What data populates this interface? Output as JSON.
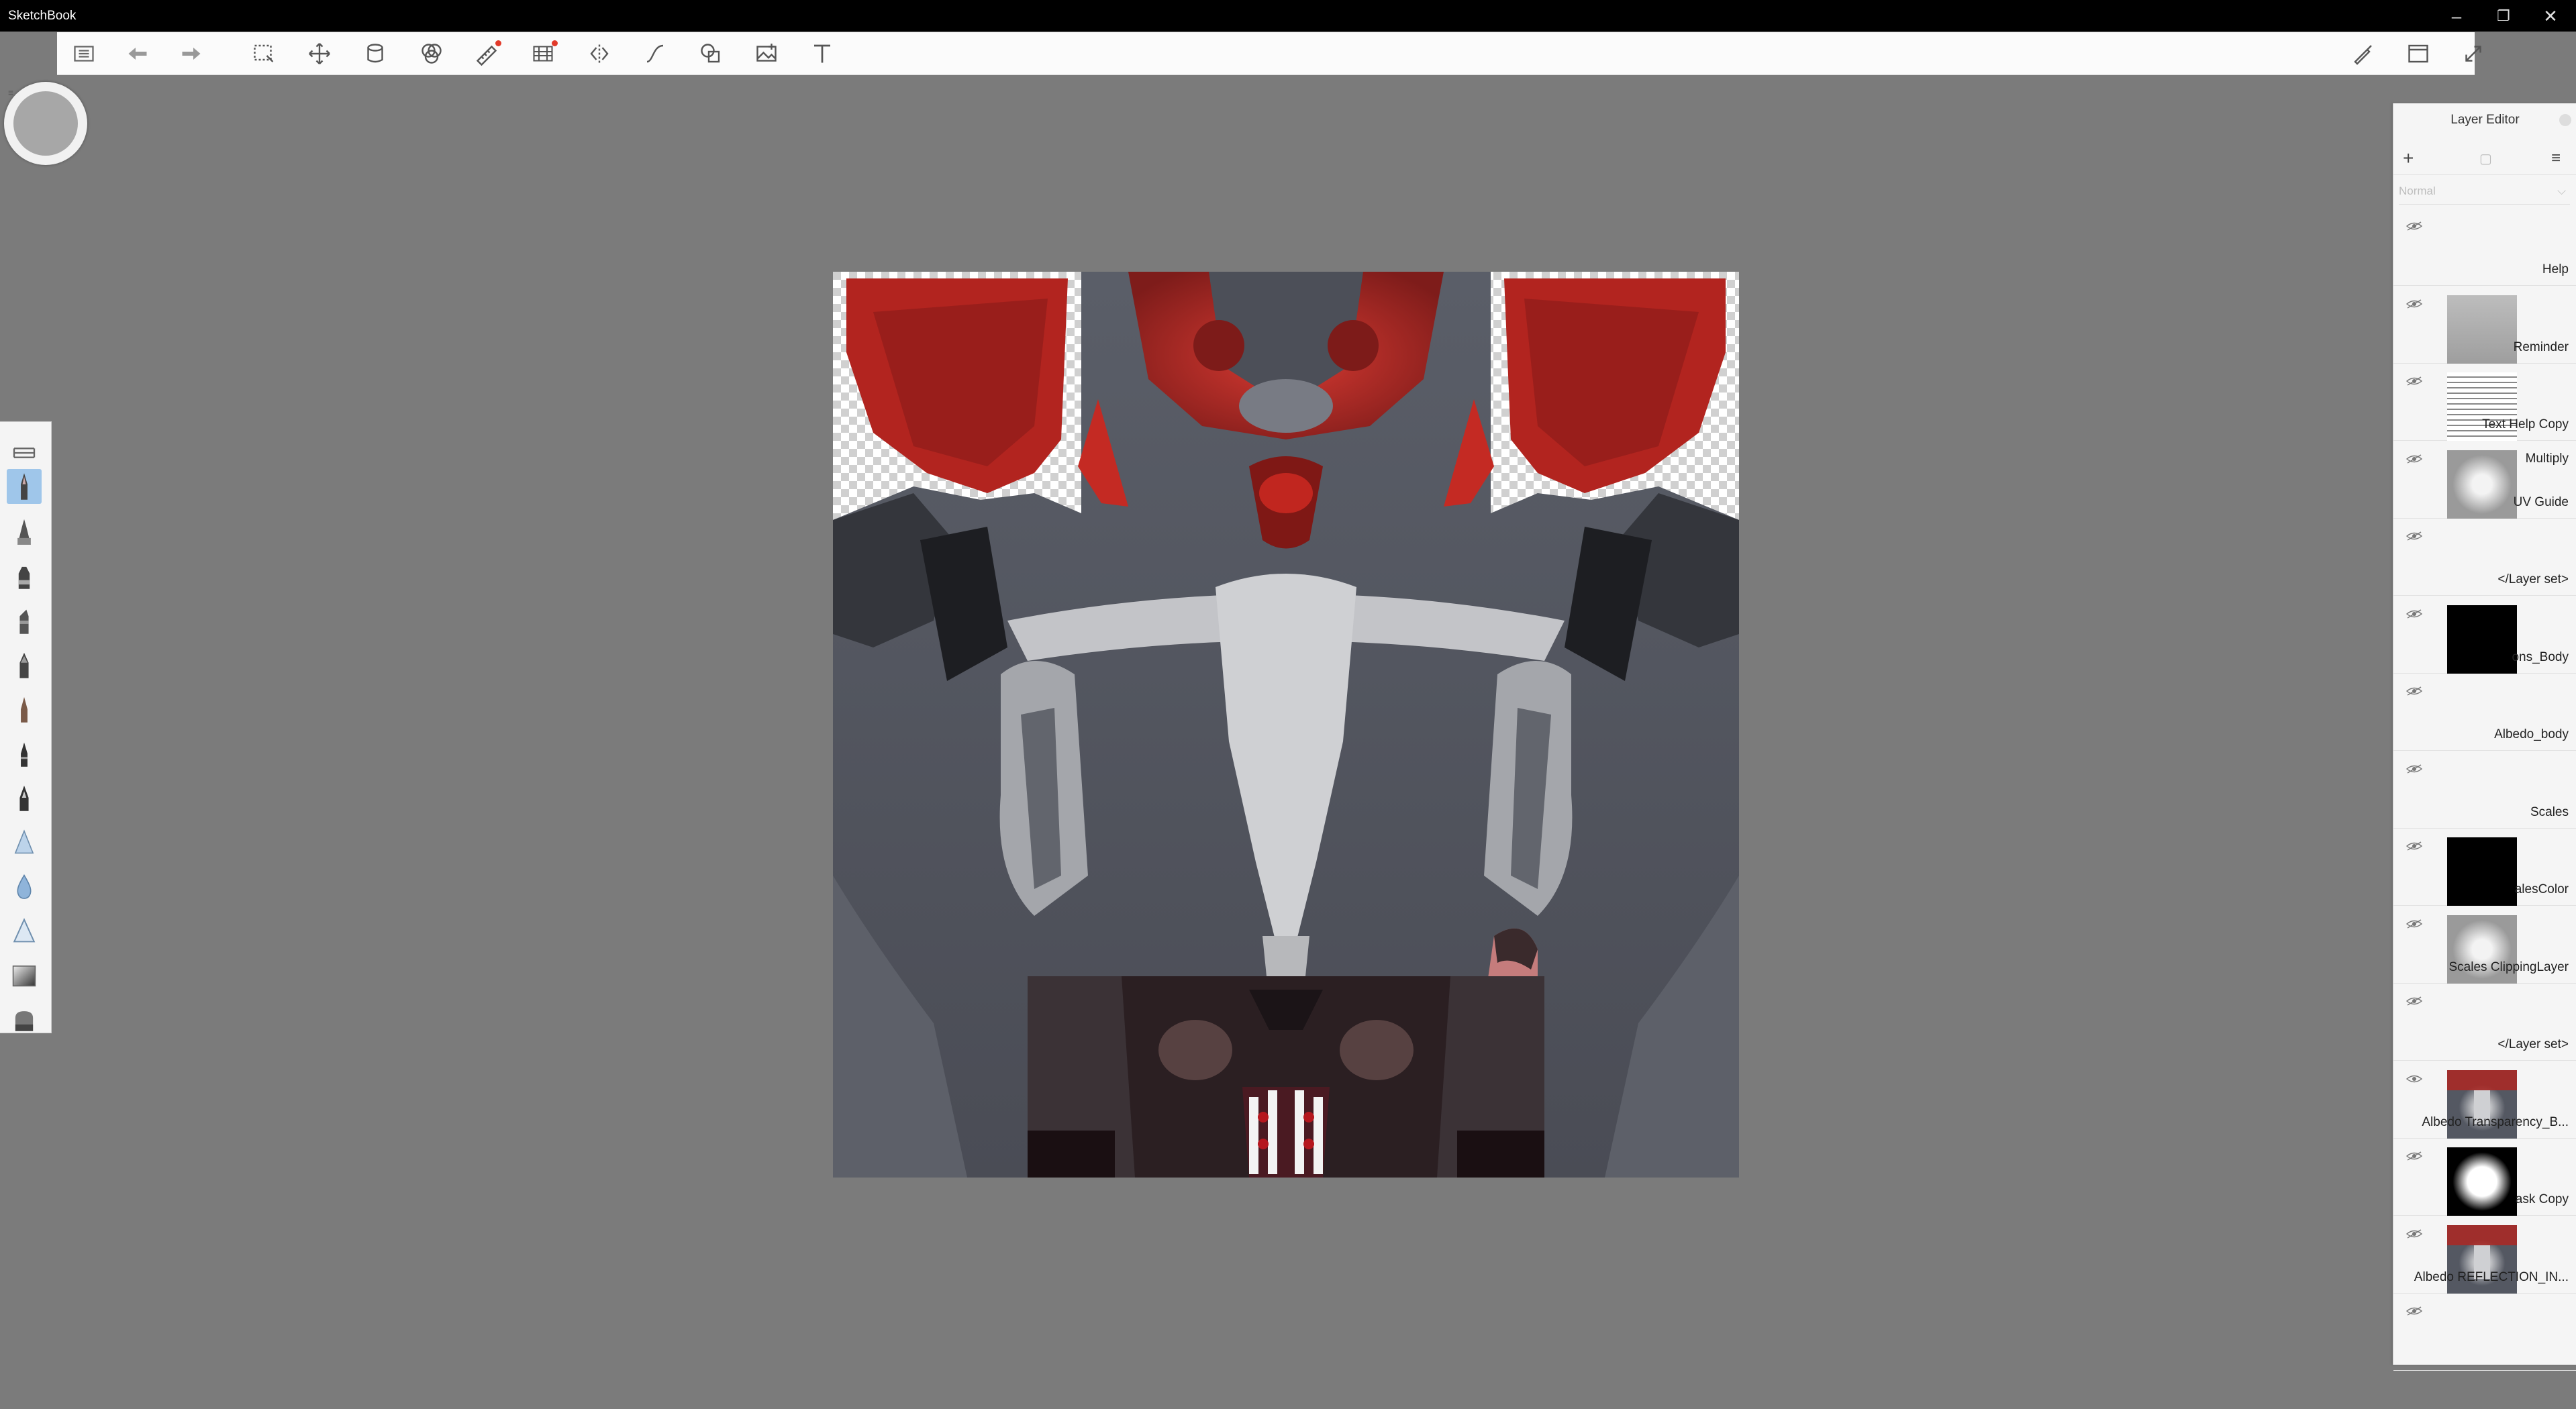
{
  "app": {
    "title": "SketchBook"
  },
  "window_controls": [
    "minimize",
    "restore",
    "close"
  ],
  "toolbar": {
    "left_icons": [
      "layers-list-icon",
      "undo-icon",
      "redo-icon",
      "selection-icon",
      "transform-icon",
      "bucket-fill-icon",
      "color-editor-icon",
      "ruler-icon",
      "perspective-guide-icon",
      "symmetry-icon",
      "stroke-icon",
      "shapes-icon",
      "image-icon",
      "text-icon"
    ],
    "right_icons": [
      "brush-edit-icon",
      "window-icon",
      "fullscreen-icon"
    ]
  },
  "puck": {
    "color": "#a7a7a7"
  },
  "brush_palette": {
    "items": [
      "library-icon",
      "pencil-brush-icon",
      "ballpoint-brush-icon",
      "marker-brush-icon",
      "chisel-brush-icon",
      "pen-brush-icon",
      "fine-pen-brush-icon",
      "technical-pen-brush-icon",
      "inking-brush-icon",
      "airbrush-icon",
      "watercolor-brush-icon",
      "triangle-brush-icon",
      "gradient-brush-icon",
      "eraser-brush-icon"
    ],
    "selected_index": 1
  },
  "layer_editor": {
    "title": "Layer Editor",
    "blend_mode": "Normal",
    "layers": [
      {
        "name": "Help",
        "thumb": "none"
      },
      {
        "name": "Reminder",
        "thumb": "gray-doc"
      },
      {
        "name": "Text Help Copy",
        "thumb": "text-lines"
      },
      {
        "name": "UV Guide",
        "sub": "Multiply",
        "thumb": "uv-gray"
      },
      {
        "name": "</Layer set>",
        "thumb": "none"
      },
      {
        "name": "ons_Body",
        "thumb": "black"
      },
      {
        "name": "Albedo_body",
        "thumb": "none"
      },
      {
        "name": "Scales",
        "thumb": "none"
      },
      {
        "name": "alesColor",
        "thumb": "black"
      },
      {
        "name": "Scales ClippingLayer",
        "thumb": "uv-gray"
      },
      {
        "name": "</Layer set>",
        "thumb": "none"
      },
      {
        "name": "Albedo Transparency_B...",
        "thumb": "albedo",
        "visible": true
      },
      {
        "name": "ask Copy",
        "thumb": "mask"
      },
      {
        "name": "Albedo REFLECTION_IN...",
        "thumb": "albedo"
      },
      {
        "name": "",
        "thumb": "none"
      }
    ]
  },
  "colors": {
    "accent": "#9fc6ea",
    "canvas_bg": "#7b7b7b",
    "red": "#c8231e"
  }
}
